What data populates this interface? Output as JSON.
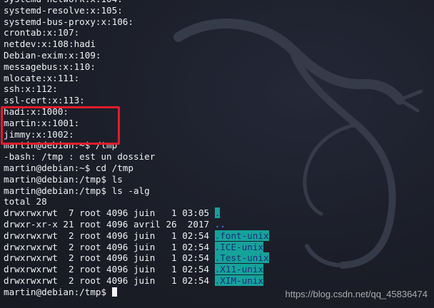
{
  "terminal": {
    "lines": [
      "systemd-network:x:104:",
      "systemd-resolve:x:105:",
      "systemd-bus-proxy:x:106:",
      "crontab:x:107:",
      "netdev:x:108:hadi",
      "Debian-exim:x:109:",
      "messagebus:x:110:",
      "mlocate:x:111:",
      "ssh:x:112:",
      "ssl-cert:x:113:",
      "hadi:x:1000:",
      "martin:x:1001:",
      "jimmy:x:1002:",
      "martin@debian:~$ /tmp",
      "-bash: /tmp : est un dossier",
      "martin@debian:~$ cd /tmp",
      "martin@debian:/tmp$ ls",
      "martin@debian:/tmp$ ls -alg",
      "total 28"
    ],
    "listing": [
      {
        "info": "drwxrwxrwt  7 root 4096 juin   1 03:05 ",
        "name": ".",
        "highlight": true,
        "dot": false
      },
      {
        "info": "drwxr-xr-x 21 root 4096 avril 26  2017 ",
        "name": "..",
        "highlight": false,
        "dot": true
      },
      {
        "info": "drwxrwxrwt  2 root 4096 juin   1 02:54 ",
        "name": ".font-unix",
        "highlight": true,
        "dot": false
      },
      {
        "info": "drwxrwxrwt  2 root 4096 juin   1 02:54 ",
        "name": ".ICE-unix",
        "highlight": true,
        "dot": false
      },
      {
        "info": "drwxrwxrwt  2 root 4096 juin   1 02:54 ",
        "name": ".Test-unix",
        "highlight": true,
        "dot": false
      },
      {
        "info": "drwxrwxrwt  2 root 4096 juin   1 02:54 ",
        "name": ".X11-unix",
        "highlight": true,
        "dot": false
      },
      {
        "info": "drwxrwxrwt  2 root 4096 juin   1 02:54 ",
        "name": ".XIM-unix",
        "highlight": true,
        "dot": false
      }
    ],
    "prompt": "martin@debian:/tmp$ ",
    "colors": {
      "highlight_bg": "#16a39a",
      "highlight_fg": "#1a2e7d",
      "annotation_box": "#e11d2b"
    }
  },
  "watermark": "https://blog.csdn.net/qq_45836474"
}
